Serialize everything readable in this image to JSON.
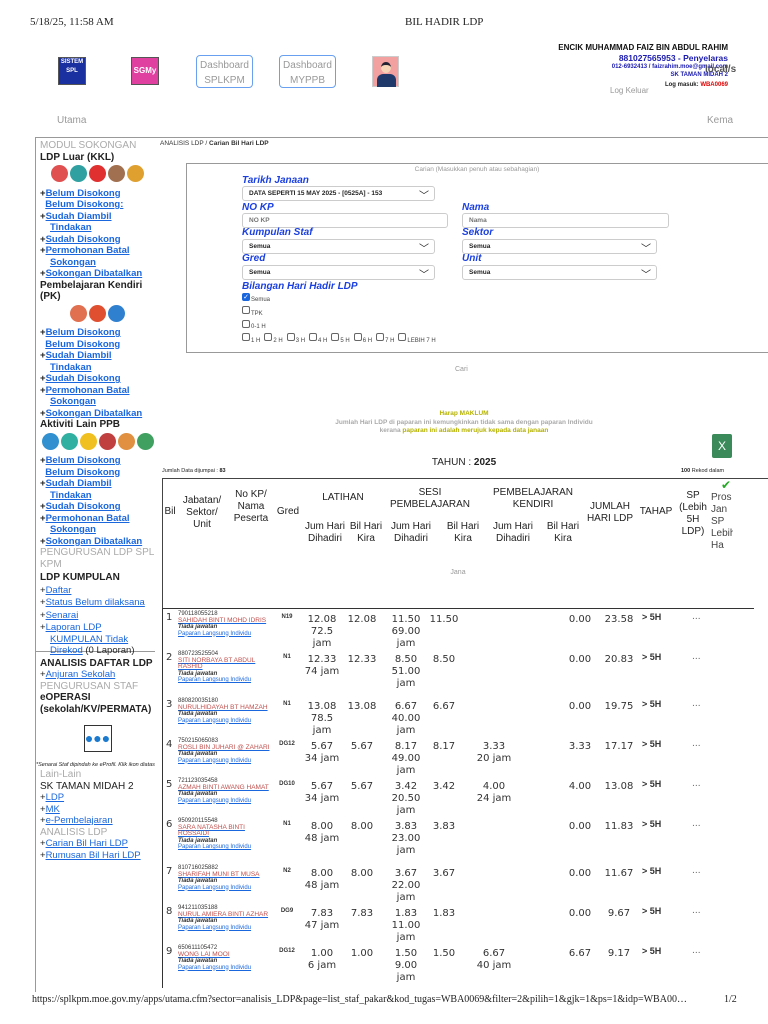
{
  "print": {
    "datetime": "5/18/25, 11:58 AM",
    "title": "BIL HADIR LDP",
    "url": "https://splkpm.moe.gov.my/apps/utama.cfm?sector=analisis_LDP&page=list_staf_pakar&kod_tugas=WBA0069&filter=2&pilih=1&gjk=1&ps=1&idp=WBA00…",
    "page": "1/2"
  },
  "header": {
    "logo1": "SISTEM SPL",
    "logo2": "SGMy",
    "dash1": [
      "Dashboard",
      "SPLKPM"
    ],
    "dash2": [
      "Dashboard",
      "MYPPB"
    ],
    "user_name": "ENCIK MUHAMMAD FAIZ BIN ABDUL RAHIM",
    "user_id": "881027565953 - Penyelaras",
    "contact": "012-6932413 / faizrahim.moe@gmail.com",
    "school": "SK TAMAN MIDAH 2",
    "login_label": "Log masuk:",
    "login_code": "WBA0069",
    "logout": "Log Keluar",
    "right_cut": "local/s",
    "nav_home": "Utama",
    "nav_right": "Kema"
  },
  "sidebar": {
    "modul": "MODUL SOKONGAN",
    "groups": [
      {
        "title": "LDP Luar (KKL)",
        "links": [
          "Belum Disokong",
          "Belum Disokong:",
          "Sudah Diambil Tindakan",
          "Sudah Disokong",
          "Permohonan Batal Sokongan",
          "Sokongan Dibatalkan"
        ]
      },
      {
        "title": "Pembelajaran Kendiri (PK)",
        "links": [
          "Belum Disokong",
          "Belum Disokong",
          "Sudah Diambil Tindakan",
          "Sudah Disokong",
          "Permohonan Batal Sokongan",
          "Sokongan Dibatalkan"
        ]
      },
      {
        "title": "Aktiviti Lain PPB",
        "links": [
          "Belum Disokong",
          "Belum Disokong",
          "Sudah Diambil Tindakan",
          "Sudah Disokong",
          "Permohonan Batal Sokongan",
          "Sokongan Dibatalkan"
        ]
      }
    ],
    "pengurusan_ldp": "PENGURUSAN LDP SPL KPM",
    "kumpulan": "LDP KUMPULAN",
    "kumpulan_links": [
      "Daftar",
      "Status Belum dilaksana",
      "Senarai",
      "Laporan LDP KUMPULAN Tidak Direkod"
    ],
    "laporan_count": "(0 Laporan)",
    "analisis_daftar": "ANALISIS DAFTAR LDP",
    "anjuran": "Anjuran Sekolah",
    "pengurusan_staf": "PENGURUSAN STAF",
    "eoperasi": "eOPERASI (sekolah/KV/PERMATA)",
    "eoperasi_note": "*Senarai Staf dipindah ke eProfil. Klik ikon diatas",
    "lain": "Lain-Lain",
    "school": "SK TAMAN MIDAH 2",
    "lain_links": [
      "LDP",
      "MK",
      "e-Pembelajaran"
    ],
    "analisis_ldp": "ANALISIS LDP",
    "analisis_links": [
      "Carian Bil Hari LDP",
      "Rumusan Bil Hari LDP"
    ]
  },
  "breadcrumb": {
    "parent": "ANALISIS LDP",
    "sep": " / ",
    "current": "Carian Bil Hari LDP"
  },
  "form": {
    "legend": "Carian (Masukkan penuh atau sebahagian)",
    "tarikh_label": "Tarikh Janaan",
    "tarikh_value": "DATA SEPERTI 15 MAY 2025 - [0525A] - 153",
    "nokp_label": "NO KP",
    "nokp_placeholder": "NO KP",
    "nama_label": "Nama",
    "nama_placeholder": "Nama",
    "kumpulan_label": "Kumpulan Staf",
    "kumpulan_value": "Semua",
    "sektor_label": "Sektor",
    "sektor_value": "Semua",
    "gred_label": "Gred",
    "gred_value": "Semua",
    "unit_label": "Unit",
    "unit_value": "Semua",
    "bilangan_label": "Bilangan Hari Hadir LDP",
    "opt_semua": "Semua",
    "opt_tpk": "TPK",
    "opt_01": "0-1 H",
    "opts": [
      "1 H",
      "2 H",
      "3 H",
      "4 H",
      "5 H",
      "6 H",
      "7 H",
      "LEBIH 7 H"
    ],
    "cari": "Cari"
  },
  "notice": {
    "title": "Harap MAKLUM",
    "line1": "Jumlah Hari LDP di paparan ini kemungkinkan tidak sama dengan paparan Individu",
    "line2a": "kerana ",
    "line2b": "paparan ini adalah merujuk kepada data janaan"
  },
  "summary": {
    "tahun_label": "TAHUN : ",
    "tahun": "2025",
    "found_label": "Jumlah Data dijumpai : ",
    "found": "83",
    "per_page": "100",
    "per_page_label": " Rekod dalam"
  },
  "table": {
    "headers": {
      "bil": "Bil",
      "jabatan": "Jabatan/ Sektor/ Unit",
      "nokp": "No KP/ Nama Peserta",
      "gred": "Gred",
      "latihan": "LATIHAN",
      "sesi": "SESI PEMBELAJARAN",
      "pk": "PEMBELAJARAN KENDIRI",
      "jum": "Jum Hari Dihadiri",
      "bilhari": "Bil Hari Kira",
      "jumlah": "JUMLAH HARI LDP",
      "tahap": "TAHAP",
      "sp": "SP (Lebih 5H LDP)",
      "proses": "Pros Jan SP Lebih Ha",
      "jana": "Jana"
    },
    "jawatan": "Tiada jawatan",
    "paparan": "Paparan Langsung Individu",
    "rows": [
      {
        "bil": "1",
        "kp": "790118055218",
        "nama": "SAHIDAH BINTI MOHD IDRIS",
        "gred": "N19",
        "lat_jum": "12.08",
        "lat_jam": "72.5 jam",
        "lat_bil": "12.08",
        "sesi_jum": "11.50",
        "sesi_jam": "69.00 jam",
        "sesi_bil": "11.50",
        "pk_jum": "",
        "pk_jam": "",
        "pk_bil": "0.00",
        "jumlah": "23.58",
        "tahap": "> 5H",
        "sp": "..."
      },
      {
        "bil": "2",
        "kp": "880723525504",
        "nama": "SITI NORBAYA BT ABDUL RASHID",
        "gred": "N1",
        "lat_jum": "12.33",
        "lat_jam": "74 jam",
        "lat_bil": "12.33",
        "sesi_jum": "8.50",
        "sesi_jam": "51.00 jam",
        "sesi_bil": "8.50",
        "pk_jum": "",
        "pk_jam": "",
        "pk_bil": "0.00",
        "jumlah": "20.83",
        "tahap": "> 5H",
        "sp": "..."
      },
      {
        "bil": "3",
        "kp": "880820035180",
        "nama": "NURULHIDAYAH BT HAMZAH",
        "gred": "N1",
        "lat_jum": "13.08",
        "lat_jam": "78.5 jam",
        "lat_bil": "13.08",
        "sesi_jum": "6.67",
        "sesi_jam": "40.00 jam",
        "sesi_bil": "6.67",
        "pk_jum": "",
        "pk_jam": "",
        "pk_bil": "0.00",
        "jumlah": "19.75",
        "tahap": "> 5H",
        "sp": "..."
      },
      {
        "bil": "4",
        "kp": "750215065083",
        "nama": "ROSLI BIN JUHARI @ ZAHARI",
        "gred": "DG12",
        "lat_jum": "5.67",
        "lat_jam": "34 jam",
        "lat_bil": "5.67",
        "sesi_jum": "8.17",
        "sesi_jam": "49.00 jam",
        "sesi_bil": "8.17",
        "pk_jum": "3.33",
        "pk_jam": "20 jam",
        "pk_bil": "3.33",
        "jumlah": "17.17",
        "tahap": "> 5H",
        "sp": "..."
      },
      {
        "bil": "5",
        "kp": "721123035458",
        "nama": "AZMAH BINTI AWANG HAMAT",
        "gred": "DG10",
        "lat_jum": "5.67",
        "lat_jam": "34 jam",
        "lat_bil": "5.67",
        "sesi_jum": "3.42",
        "sesi_jam": "20.50 jam",
        "sesi_bil": "3.42",
        "pk_jum": "4.00",
        "pk_jam": "24 jam",
        "pk_bil": "4.00",
        "jumlah": "13.08",
        "tahap": "> 5H",
        "sp": "..."
      },
      {
        "bil": "6",
        "kp": "950920115548",
        "nama": "SARA NATASHA BINTI ROSSAIDI",
        "gred": "N1",
        "lat_jum": "8.00",
        "lat_jam": "48 jam",
        "lat_bil": "8.00",
        "sesi_jum": "3.83",
        "sesi_jam": "23.00 jam",
        "sesi_bil": "3.83",
        "pk_jum": "",
        "pk_jam": "",
        "pk_bil": "0.00",
        "jumlah": "11.83",
        "tahap": "> 5H",
        "sp": "..."
      },
      {
        "bil": "7",
        "kp": "810716025882",
        "nama": "SHARIFAH MUNI BT MUSA",
        "gred": "N2",
        "lat_jum": "8.00",
        "lat_jam": "48 jam",
        "lat_bil": "8.00",
        "sesi_jum": "3.67",
        "sesi_jam": "22.00 jam",
        "sesi_bil": "3.67",
        "pk_jum": "",
        "pk_jam": "",
        "pk_bil": "0.00",
        "jumlah": "11.67",
        "tahap": "> 5H",
        "sp": "..."
      },
      {
        "bil": "8",
        "kp": "941211035188",
        "nama": "NURUL AMIERA BINTI AZHAR",
        "gred": "DG9",
        "lat_jum": "7.83",
        "lat_jam": "47 jam",
        "lat_bil": "7.83",
        "sesi_jum": "1.83",
        "sesi_jam": "11.00 jam",
        "sesi_bil": "1.83",
        "pk_jum": "",
        "pk_jam": "",
        "pk_bil": "0.00",
        "jumlah": "9.67",
        "tahap": "> 5H",
        "sp": "..."
      },
      {
        "bil": "9",
        "kp": "650611105472",
        "nama": "WONG LAI MOOI",
        "gred": "DG12",
        "lat_jum": "1.00",
        "lat_jam": "6 jam",
        "lat_bil": "1.00",
        "sesi_jum": "1.50",
        "sesi_jam": "9.00 jam",
        "sesi_bil": "1.50",
        "pk_jum": "6.67",
        "pk_jam": "40 jam",
        "pk_bil": "6.67",
        "jumlah": "9.17",
        "tahap": "> 5H",
        "sp": "..."
      }
    ]
  },
  "colors": {
    "link": "#1a66dd",
    "label": "#1a3fe0",
    "name": "#c0504d",
    "notice": "#b5b300",
    "login_code": "#e00000"
  }
}
